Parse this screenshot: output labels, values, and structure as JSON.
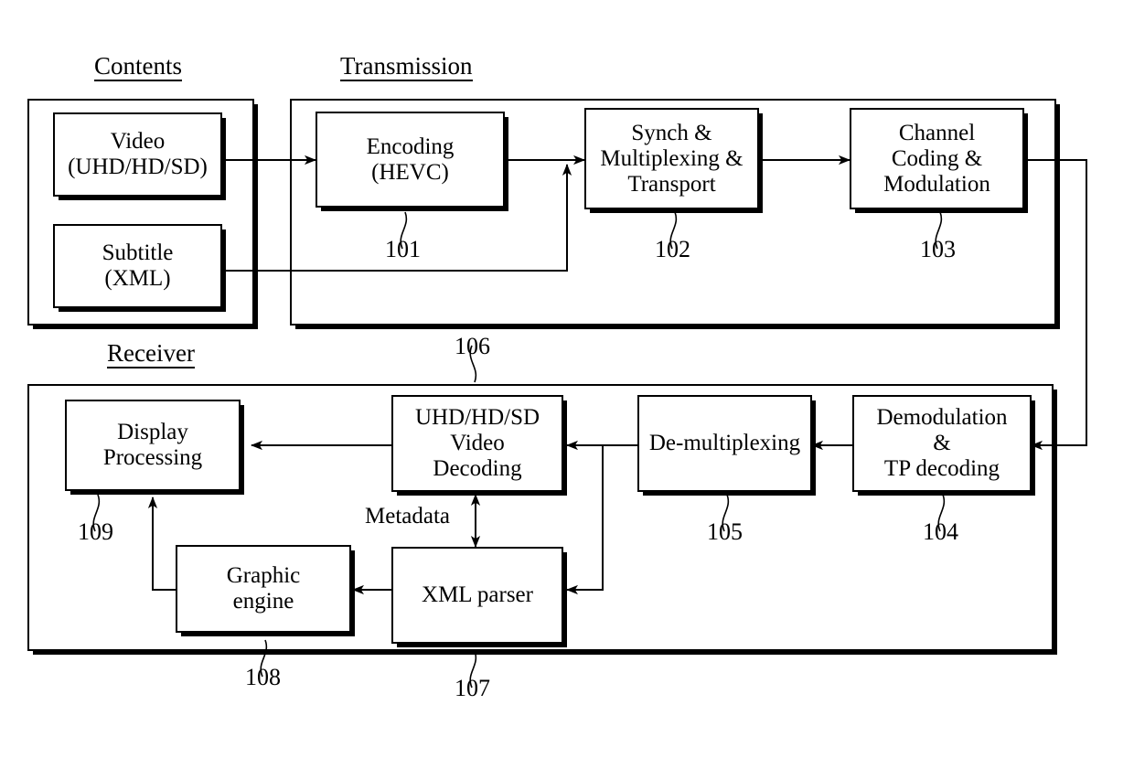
{
  "figure": {
    "type": "block-diagram",
    "sections": [
      {
        "id": "contents",
        "title": "Contents"
      },
      {
        "id": "transmission",
        "title": "Transmission"
      },
      {
        "id": "receiver",
        "title": "Receiver"
      }
    ],
    "blocks": [
      {
        "id": "video",
        "line1": "Video",
        "line2": "(UHD/HD/SD)",
        "line3": "",
        "ref": ""
      },
      {
        "id": "subtitle",
        "line1": "Subtitle",
        "line2": "(XML)",
        "line3": "",
        "ref": ""
      },
      {
        "id": "encoding",
        "line1": "Encoding",
        "line2": "(HEVC)",
        "line3": "",
        "ref": "101"
      },
      {
        "id": "synch",
        "line1": "Synch &",
        "line2": "Multiplexing &",
        "line3": "Transport",
        "ref": "102"
      },
      {
        "id": "channel",
        "line1": "Channel",
        "line2": "Coding &",
        "line3": "Modulation",
        "ref": "103"
      },
      {
        "id": "demodulation",
        "line1": "Demodulation",
        "line2": "&",
        "line3": "TP decoding",
        "ref": "104"
      },
      {
        "id": "demux",
        "line1": "De-multiplexing",
        "line2": "",
        "line3": "",
        "ref": "105"
      },
      {
        "id": "videodec",
        "line1": "UHD/HD/SD",
        "line2": "Video",
        "line3": "Decoding",
        "ref": "106"
      },
      {
        "id": "xmlparser",
        "line1": "XML parser",
        "line2": "",
        "line3": "",
        "ref": "107"
      },
      {
        "id": "graphic",
        "line1": "Graphic",
        "line2": "engine",
        "line3": "",
        "ref": "108"
      },
      {
        "id": "display",
        "line1": "Display",
        "line2": "Processing",
        "line3": "",
        "ref": "109"
      }
    ],
    "annotations": [
      {
        "id": "metadata",
        "text": "Metadata"
      }
    ],
    "colors": {
      "ink": "#000000",
      "paper": "#ffffff"
    }
  }
}
